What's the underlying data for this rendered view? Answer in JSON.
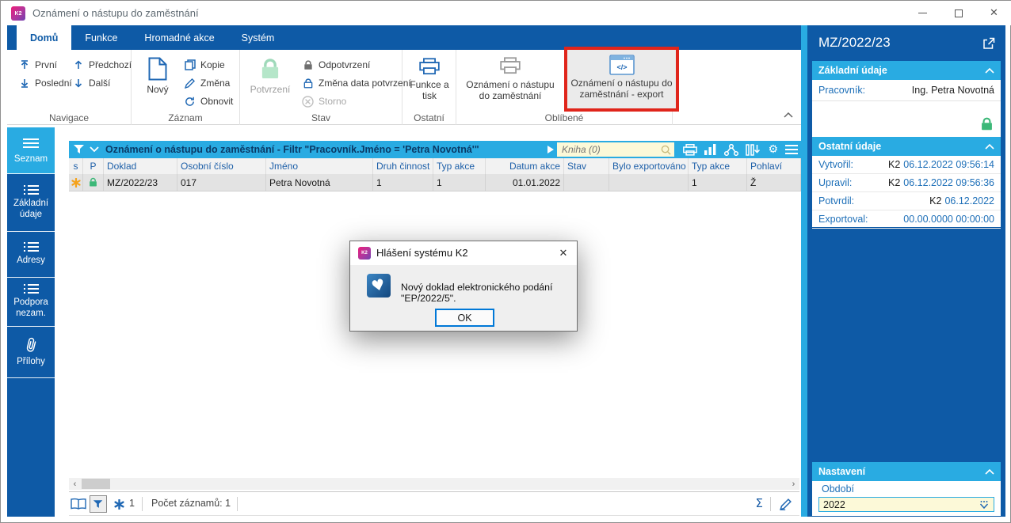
{
  "window": {
    "title": "Oznámení o nástupu do zaměstnání",
    "logo": "K2"
  },
  "ribbon": {
    "tabs": [
      {
        "label": "Domů"
      },
      {
        "label": "Funkce"
      },
      {
        "label": "Hromadné akce"
      },
      {
        "label": "Systém"
      }
    ],
    "navigace": {
      "label": "Navigace",
      "prvni": "První",
      "posledni": "Poslední",
      "predchozi": "Předchozí",
      "dalsi": "Další"
    },
    "zaznam": {
      "label": "Záznam",
      "novy": "Nový",
      "kopie": "Kopie",
      "zmena": "Změna",
      "obnovit": "Obnovit"
    },
    "stav": {
      "label": "Stav",
      "potvrzeni": "Potvrzení",
      "odpotvrzeni": "Odpotvrzení",
      "zmena_data": "Změna data potvrzení",
      "storno": "Storno"
    },
    "ostatni": {
      "label": "Ostatní",
      "funkce_a_tisk": "Funkce a tisk"
    },
    "oblibene": {
      "label": "Oblíbené",
      "tisk": "Oznámení o nástupu do zaměstnání",
      "export": "Oznámení o nástupu do zaměstnání - export"
    }
  },
  "sidebar": {
    "items": [
      {
        "label": "Seznam"
      },
      {
        "label": "Základní údaje"
      },
      {
        "label": "Adresy"
      },
      {
        "label": "Podpora nezam."
      },
      {
        "label": "Přílohy"
      }
    ]
  },
  "browse": {
    "filter_title": "Oznámení o nástupu do zaměstnání - Filtr \"Pracovník.Jméno = 'Petra Novotná'\"",
    "book_placeholder": "Kniha (0)"
  },
  "table": {
    "columns": [
      "s",
      "P",
      "Doklad",
      "Osobní číslo",
      "Jméno",
      "Druh činnost",
      "Typ akce",
      "Datum akce",
      "Stav",
      "Bylo exportováno",
      "Typ akce",
      "Pohlaví"
    ],
    "row": {
      "doklad": "MZ/2022/23",
      "osobni_cislo": "017",
      "jmeno": "Petra Novotná",
      "druh_cinnost": "1",
      "typ_akce": "1",
      "datum_akce": "01.01.2022",
      "stav": "",
      "bylo_exportovano": "",
      "typ_akce_2": "1",
      "pohlavi": "Ž"
    }
  },
  "statusbar": {
    "star_count": "1",
    "record_count": "Počet záznamů: 1",
    "sigma_icon": "Σ"
  },
  "icons": {
    "gear": "⚙",
    "close": "✕",
    "heart": "♥",
    "arrow_left": "‹",
    "arrow_right": "›"
  },
  "panel": {
    "title": "MZ/2022/23",
    "zakladni": {
      "header": "Základní údaje",
      "pracovnik_label": "Pracovník:",
      "pracovnik_value": "Ing. Petra Novotná"
    },
    "ostatni": {
      "header": "Ostatní údaje",
      "rows": [
        {
          "label": "Vytvořil:",
          "who": "K2",
          "when": "06.12.2022 09:56:14"
        },
        {
          "label": "Upravil:",
          "who": "K2",
          "when": "06.12.2022 09:56:36"
        },
        {
          "label": "Potvrdil:",
          "who": "K2",
          "when": "06.12.2022"
        },
        {
          "label": "Exportoval:",
          "who": "",
          "when": "00.00.0000 00:00:00"
        }
      ]
    },
    "nastaveni": {
      "header": "Nastavení",
      "obdobi_label": "Období",
      "obdobi_value": "2022"
    }
  },
  "dialog": {
    "title": "Hlášení systému K2",
    "message": "Nový doklad elektronického podání \"EP/2022/5\".",
    "ok_label": "OK"
  }
}
